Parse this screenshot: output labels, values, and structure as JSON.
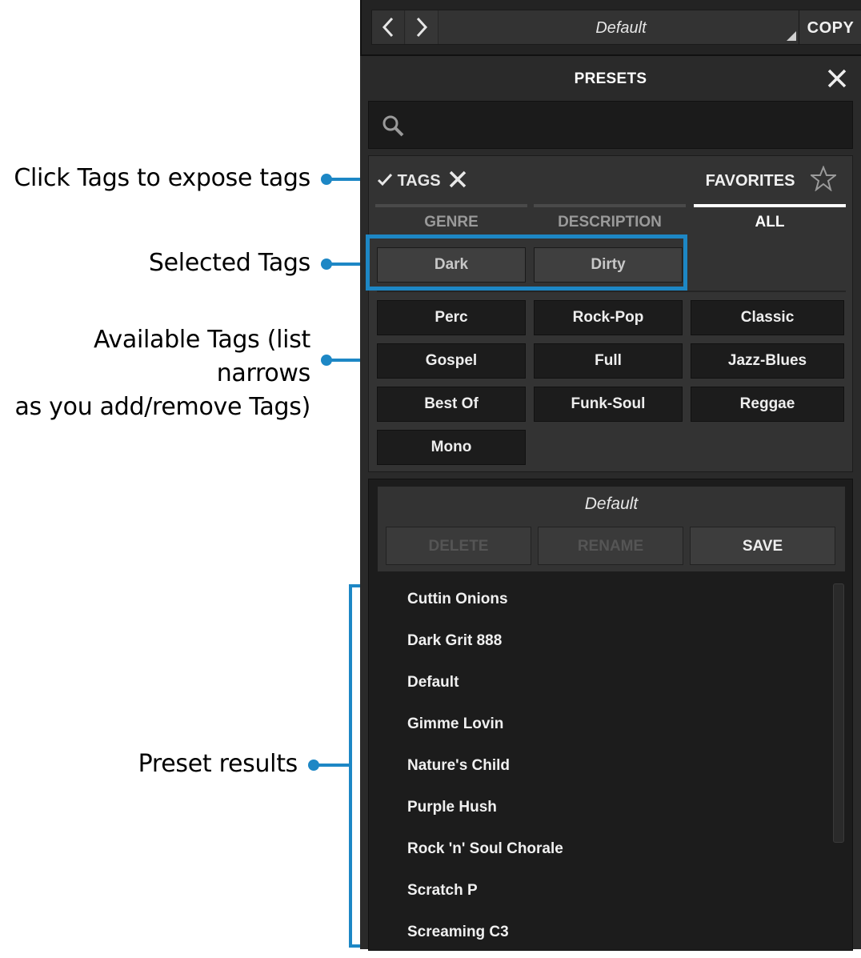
{
  "annotations": {
    "tags": "Click Tags to expose tags",
    "selected": "Selected Tags",
    "available_line1": "Available Tags (list narrows",
    "available_line2": "as you add/remove Tags)",
    "results": "Preset results",
    "color": "#1d87c5"
  },
  "topbar": {
    "prev_icon": "chevron-left-icon",
    "next_icon": "chevron-right-icon",
    "preset_name": "Default",
    "copy_label": "COPY"
  },
  "panel": {
    "title": "PRESETS",
    "close_icon": "close-icon",
    "search_icon": "search-icon",
    "search_value": ""
  },
  "tags": {
    "toggle_label": "TAGS",
    "favorites_label": "FAVORITES",
    "tabs": [
      {
        "label": "GENRE",
        "active": false
      },
      {
        "label": "DESCRIPTION",
        "active": false
      },
      {
        "label": "ALL",
        "active": true
      }
    ],
    "selected": [
      "Dark",
      "Dirty"
    ],
    "available": [
      "Perc",
      "Rock-Pop",
      "Classic",
      "Gospel",
      "Full",
      "Jazz-Blues",
      "Best Of",
      "Funk-Soul",
      "Reggae",
      "Mono"
    ]
  },
  "presets": {
    "current": "Default",
    "delete_label": "DELETE",
    "rename_label": "RENAME",
    "save_label": "SAVE",
    "items": [
      "Cuttin Onions",
      "Dark Grit 888",
      "Default",
      "Gimme Lovin",
      "Nature's Child",
      "Purple Hush",
      "Rock 'n' Soul Chorale",
      "Scratch P",
      "Screaming C3"
    ]
  }
}
